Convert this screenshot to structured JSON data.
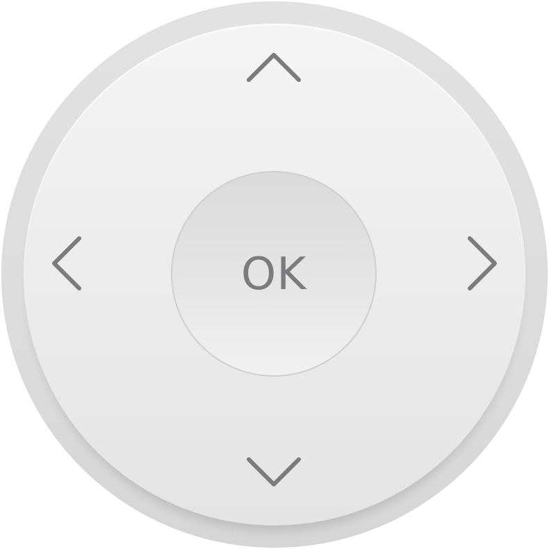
{
  "dpad": {
    "ok_label": "OK",
    "icons": {
      "up": "chevron-up-icon",
      "down": "chevron-down-icon",
      "left": "chevron-left-icon",
      "right": "chevron-right-icon"
    },
    "colors": {
      "ring": "#dddddd",
      "face": "#ececec",
      "center": "#e4e4e4",
      "glyph": "#7b7b7d"
    }
  }
}
